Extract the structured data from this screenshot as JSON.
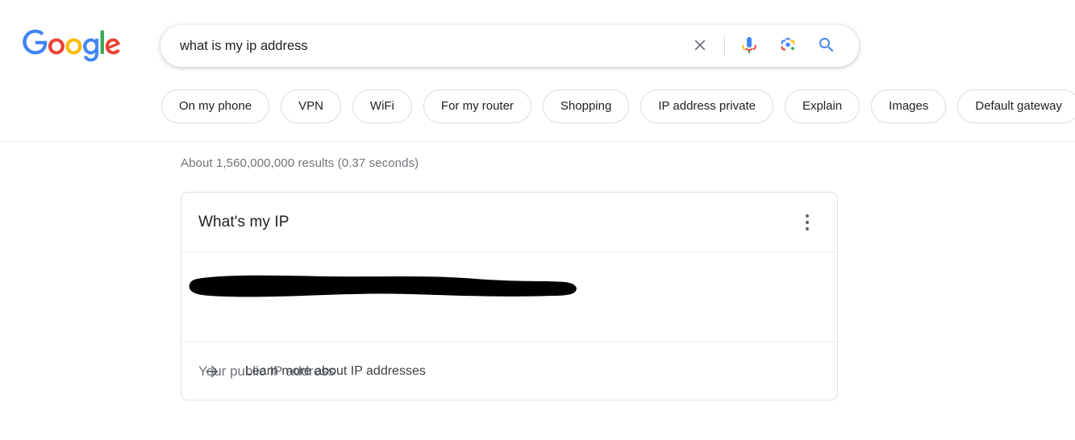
{
  "brand": {
    "logo_text": "Google",
    "logo_colors": {
      "blue": "#4285F4",
      "red": "#EA4335",
      "yellow": "#FBBC05",
      "green": "#34A853"
    }
  },
  "search": {
    "query": "what is my ip address",
    "placeholder": "Search",
    "clear_label": "Clear",
    "voice_label": "Search by voice",
    "lens_label": "Search by image",
    "submit_label": "Google Search"
  },
  "chips": [
    {
      "label": "On my phone"
    },
    {
      "label": "VPN"
    },
    {
      "label": "WiFi"
    },
    {
      "label": "For my router"
    },
    {
      "label": "Shopping"
    },
    {
      "label": "IP address private"
    },
    {
      "label": "Explain"
    },
    {
      "label": "Images"
    },
    {
      "label": "Default gateway"
    }
  ],
  "results": {
    "stats": "About 1,560,000,000 results (0.37 seconds)"
  },
  "answer_card": {
    "title": "What's my IP",
    "menu_label": "About this result",
    "ip_value": "",
    "ip_redacted": true,
    "ip_caption": "Your public IP address",
    "footer_link": "Learn more about IP addresses"
  },
  "colors": {
    "text_primary": "#202124",
    "text_secondary": "#70757a",
    "border": "#dfe1e5",
    "accent_blue": "#4285F4",
    "redaction": "#000000"
  }
}
